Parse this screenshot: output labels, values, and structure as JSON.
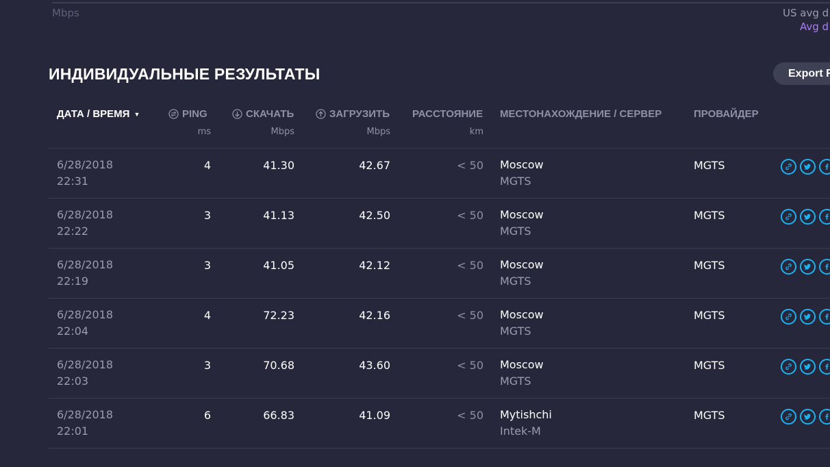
{
  "chart": {
    "unit_label": "Mbps",
    "legend_us": "US avg d",
    "legend_avg": "Avg d"
  },
  "section": {
    "title": "ИНДИВИДУАЛЬНЫЕ РЕЗУЛЬТАТЫ",
    "export_label": "Export R"
  },
  "table": {
    "headers": {
      "datetime": "ДАТА / ВРЕМЯ",
      "ping": "PING",
      "download": "СКАЧАТЬ",
      "upload": "ЗАГРУЗИТЬ",
      "distance": "РАССТОЯНИЕ",
      "location": "МЕСТОНАХОЖДЕНИЕ / СЕРВЕР",
      "provider": "ПРОВАЙДЕР"
    },
    "units": {
      "ping": "ms",
      "download": "Mbps",
      "upload": "Mbps",
      "distance": "km"
    },
    "rows": [
      {
        "date": "6/28/2018",
        "time": "22:31",
        "ping": "4",
        "download": "41.30",
        "upload": "42.67",
        "distance": "< 50",
        "location": "Moscow",
        "server": "MGTS",
        "provider": "MGTS"
      },
      {
        "date": "6/28/2018",
        "time": "22:22",
        "ping": "3",
        "download": "41.13",
        "upload": "42.50",
        "distance": "< 50",
        "location": "Moscow",
        "server": "MGTS",
        "provider": "MGTS"
      },
      {
        "date": "6/28/2018",
        "time": "22:19",
        "ping": "3",
        "download": "41.05",
        "upload": "42.12",
        "distance": "< 50",
        "location": "Moscow",
        "server": "MGTS",
        "provider": "MGTS"
      },
      {
        "date": "6/28/2018",
        "time": "22:04",
        "ping": "4",
        "download": "72.23",
        "upload": "42.16",
        "distance": "< 50",
        "location": "Moscow",
        "server": "MGTS",
        "provider": "MGTS"
      },
      {
        "date": "6/28/2018",
        "time": "22:03",
        "ping": "3",
        "download": "70.68",
        "upload": "43.60",
        "distance": "< 50",
        "location": "Moscow",
        "server": "MGTS",
        "provider": "MGTS"
      },
      {
        "date": "6/28/2018",
        "time": "22:01",
        "ping": "6",
        "download": "66.83",
        "upload": "41.09",
        "distance": "< 50",
        "location": "Mytishchi",
        "server": "Intek-M",
        "provider": "MGTS"
      }
    ]
  },
  "colors": {
    "background": "#26273a",
    "accent_purple": "#a97ef0",
    "share_blue": "#1bb3f2"
  },
  "icons": {
    "ping": "ping-icon",
    "download": "download-arrow-icon",
    "upload": "upload-arrow-icon",
    "share": [
      "link-icon",
      "twitter-icon",
      "facebook-icon"
    ]
  }
}
